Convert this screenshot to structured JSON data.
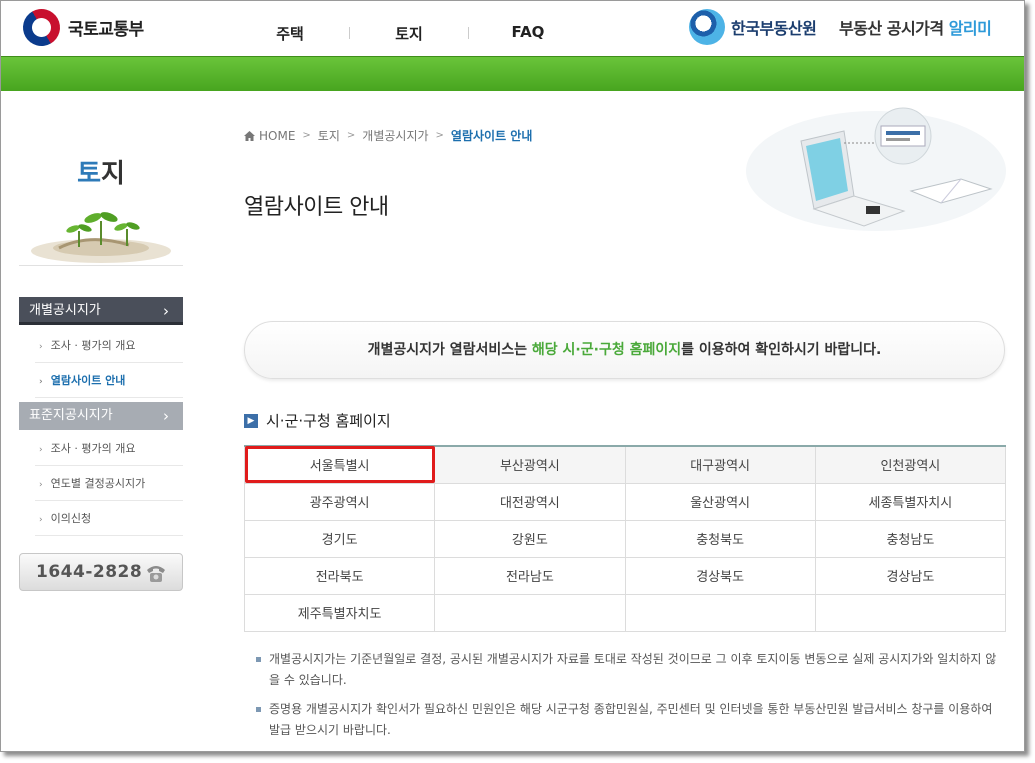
{
  "header": {
    "ministry": "국토교통부",
    "nav": [
      "주택",
      "토지",
      "FAQ"
    ],
    "agency": "한국부동산원",
    "service_prefix": "부동산 공시가격 ",
    "service_accent": "알리미"
  },
  "sidebar": {
    "title_accent": "토",
    "title_rest": "지",
    "menu_active": "개별공시지가",
    "menu_active_subs": [
      "조사 · 평가의 개요",
      "열람사이트 안내"
    ],
    "menu_inactive": "표준지공시지가",
    "menu_inactive_subs": [
      "조사 · 평가의 개요",
      "연도별 결정공시지가",
      "이의신청"
    ],
    "phone": "1644-2828"
  },
  "breadcrumb": {
    "home": "HOME",
    "items": [
      "토지",
      "개별공시지가"
    ],
    "current": "열람사이트 안내"
  },
  "page_title": "열람사이트 안내",
  "notice": {
    "before": "개별공시지가 열람서비스는 ",
    "highlight": "해당 시·군·구청 홈페이지",
    "after": "를 이용하여 확인하시기 바랍니다."
  },
  "section_title": "시·군·구청 홈페이지",
  "regions": [
    [
      "서울특별시",
      "부산광역시",
      "대구광역시",
      "인천광역시"
    ],
    [
      "광주광역시",
      "대전광역시",
      "울산광역시",
      "세종특별자치시"
    ],
    [
      "경기도",
      "강원도",
      "충청북도",
      "충청남도"
    ],
    [
      "전라북도",
      "전라남도",
      "경상북도",
      "경상남도"
    ],
    [
      "제주특별자치도",
      "",
      "",
      ""
    ]
  ],
  "notes": [
    "개별공시지가는 기준년월일로 결정, 공시된 개별공시지가 자료를 토대로 작성된 것이므로 그 이후 토지이동 변동으로 실제 공시지가와 일치하지 않을 수 있습니다.",
    "증명용 개별공시지가 확인서가 필요하신 민원인은 해당 시군구청 종합민원실, 주민센터 및 인터넷을 통한 부동산민원 발급서비스 창구를 이용하여 발급 받으시기 바랍니다."
  ],
  "colors": {
    "brand_green": "#48a51f",
    "highlight_green": "#4aa93a",
    "link_blue": "#1d6fae",
    "selection_red": "#e01b1b"
  }
}
